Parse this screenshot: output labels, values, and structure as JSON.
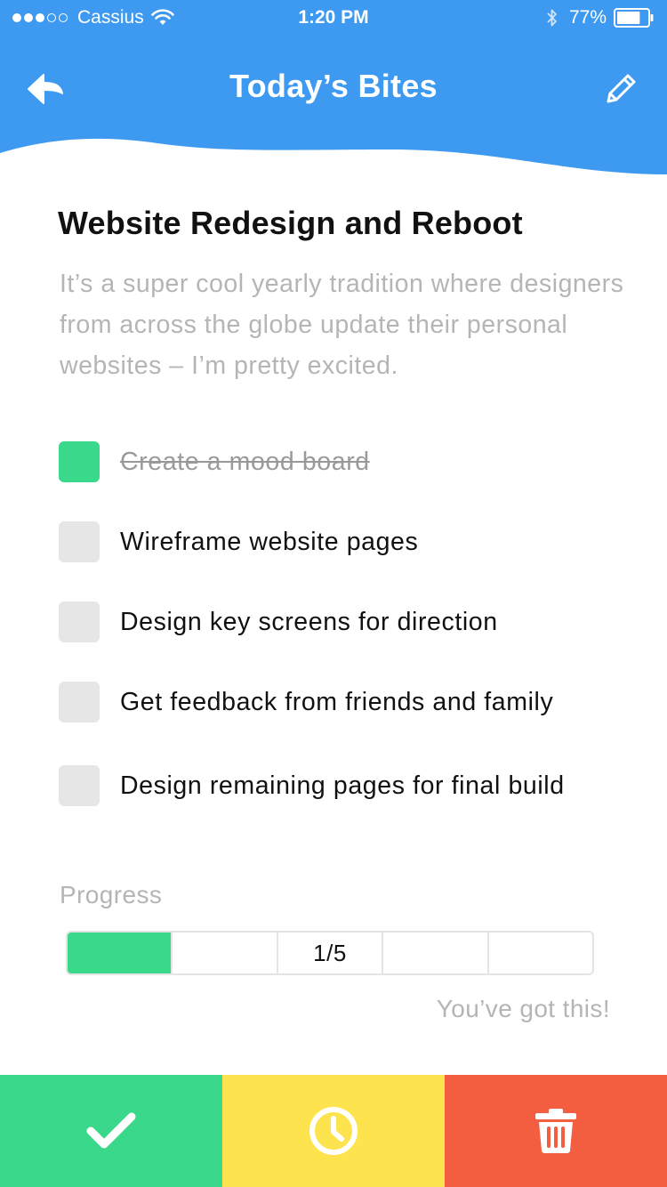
{
  "status_bar": {
    "carrier": "Cassius",
    "time": "1:20 PM",
    "battery": "77%",
    "battery_level": 0.77,
    "signal_bars_filled": 3,
    "signal_bars_total": 5
  },
  "nav": {
    "title": "Today’s Bites",
    "back_icon": "arrow-left-icon",
    "edit_icon": "pencil-icon"
  },
  "task": {
    "title": "Website Redesign and Reboot",
    "description": "It’s a super cool yearly tradition where designers from across the globe update their personal websites – I’m pretty excited."
  },
  "checklist": [
    {
      "label": "Create a mood board",
      "checked": true
    },
    {
      "label": "Wireframe website pages",
      "checked": false
    },
    {
      "label": "Design key screens for direction",
      "checked": false
    },
    {
      "label": "Get feedback from friends and family",
      "checked": false
    },
    {
      "label": "Design remaining pages for final build",
      "checked": false
    }
  ],
  "progress": {
    "label": "Progress",
    "completed": 1,
    "total": 5,
    "count_text": "1/5",
    "message": "You’ve got this!"
  },
  "actions": [
    {
      "name": "complete",
      "icon": "checkmark-icon",
      "color": "#3ad88a"
    },
    {
      "name": "snooze",
      "icon": "clock-icon",
      "color": "#fde44e"
    },
    {
      "name": "delete",
      "icon": "trash-icon",
      "color": "#f45e40"
    }
  ],
  "colors": {
    "header_blue": "#3d9af0",
    "accent_green": "#3ad88a",
    "muted_text": "#b5b5b5",
    "checkbox_empty": "#e6e6e6"
  }
}
